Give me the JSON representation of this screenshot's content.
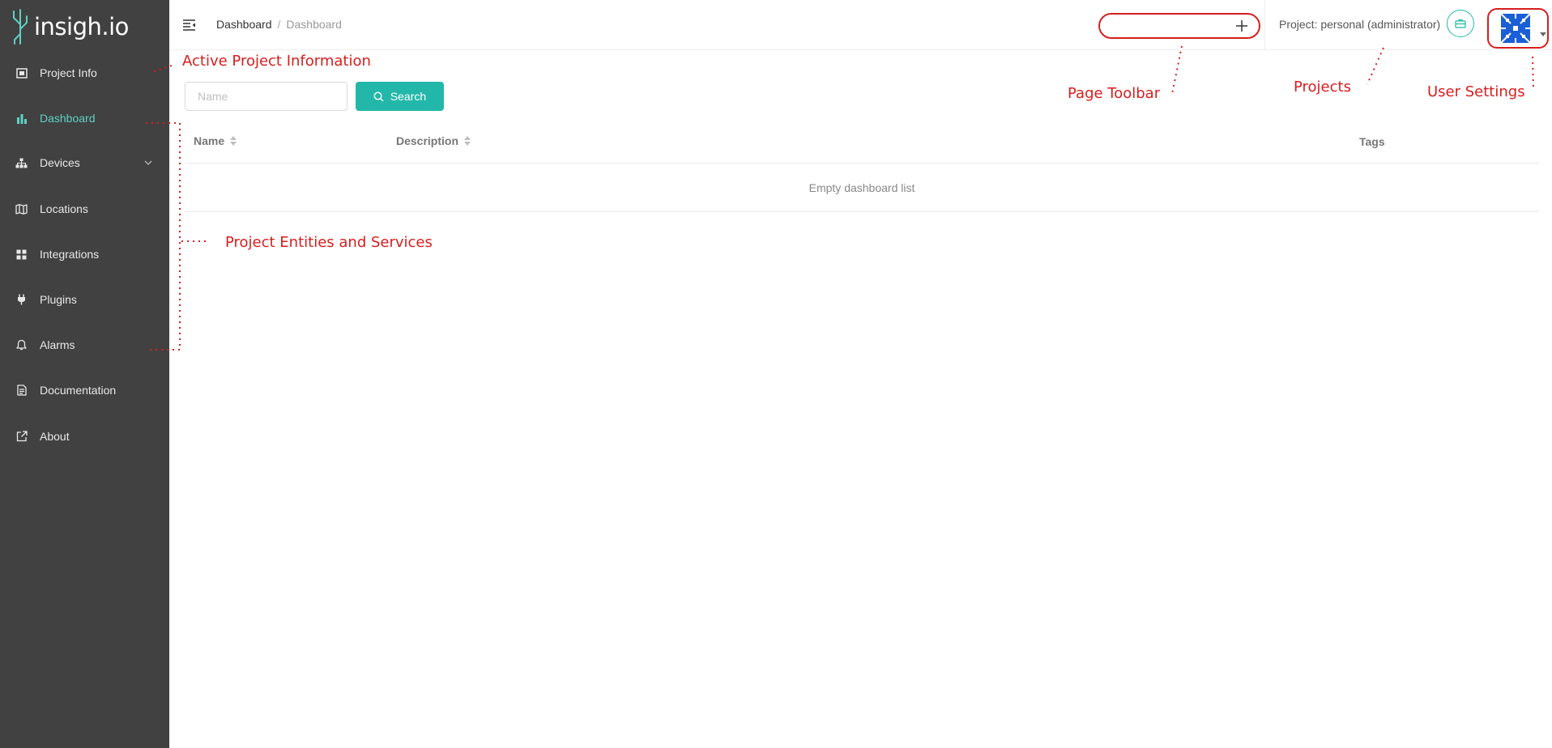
{
  "app": {
    "logo_text": "insigh.io"
  },
  "sidebar": {
    "items": [
      {
        "label": "Project Info",
        "icon": "project-info-icon"
      },
      {
        "label": "Dashboard",
        "icon": "bar-chart-icon",
        "active": true
      },
      {
        "label": "Devices",
        "icon": "devices-tree-icon",
        "expandable": true
      },
      {
        "label": "Locations",
        "icon": "map-icon"
      },
      {
        "label": "Integrations",
        "icon": "grid-icon"
      },
      {
        "label": "Plugins",
        "icon": "plug-icon"
      },
      {
        "label": "Alarms",
        "icon": "bell-icon"
      },
      {
        "label": "Documentation",
        "icon": "document-icon"
      },
      {
        "label": "About",
        "icon": "external-link-icon"
      }
    ]
  },
  "header": {
    "breadcrumb": [
      "Dashboard",
      "Dashboard"
    ],
    "breadcrumb_separator": "/",
    "project_label": "Project: personal (administrator)"
  },
  "search": {
    "placeholder": "Name",
    "button_label": "Search"
  },
  "table": {
    "columns": [
      "Name",
      "Description",
      "Tags"
    ],
    "empty_text": "Empty dashboard list"
  },
  "annotations": {
    "active_project": "Active Project Information",
    "entities": "Project Entities and Services",
    "page_toolbar": "Page Toolbar",
    "projects": "Projects",
    "user_settings": "User Settings"
  },
  "colors": {
    "sidebar_bg": "#414141",
    "accent": "#23b7a9",
    "active_nav": "#5fd1c2",
    "annotation": "#d61e1e"
  }
}
